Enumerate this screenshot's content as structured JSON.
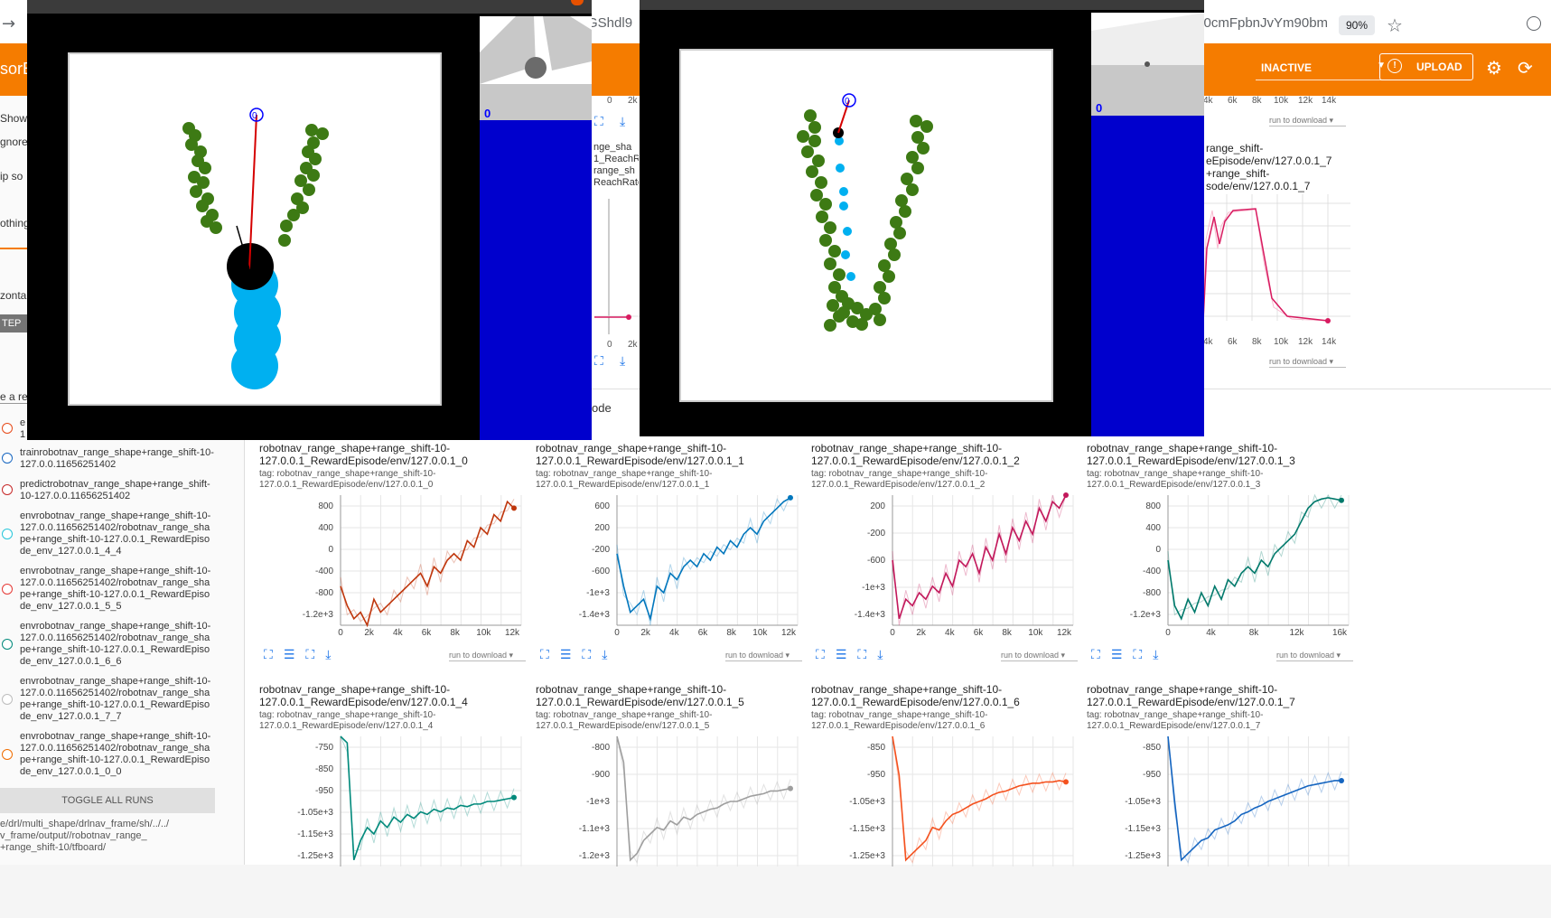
{
  "browser": {
    "address_left": "GShdl9",
    "address_right": "J0cmFpbnJvYm90bm",
    "zoom": "90%"
  },
  "toolbar": {
    "brand": "sorB",
    "status_dropdown": "INACTIVE",
    "upload_label": "UPLOAD",
    "accent_color": "#f57c00"
  },
  "sidebar": {
    "fragments": [
      "Show",
      "gnore",
      "ip so",
      "othing",
      "zontal",
      "TEP",
      "e a reg"
    ],
    "runs": [
      {
        "label": "e",
        "sub": "1",
        "color": "#e64a19"
      },
      {
        "label": "trainrobotnav_range_shape+range_shift-10-127.0.0.11656251402",
        "color": "#1565c0"
      },
      {
        "label": "predictrobotnav_range_shape+range_shift-10-127.0.0.11656251402",
        "color": "#c62828"
      },
      {
        "label": "envrobotnav_range_shape+range_shift-10-127.0.0.11656251402/robotnav_range_shape+range_shift-10-127.0.0.1_RewardEpisode_env_127.0.0.1_4_4",
        "color": "#26c6da"
      },
      {
        "label": "envrobotnav_range_shape+range_shift-10-127.0.0.11656251402/robotnav_range_shape+range_shift-10-127.0.0.1_RewardEpisode_env_127.0.0.1_5_5",
        "color": "#e53935"
      },
      {
        "label": "envrobotnav_range_shape+range_shift-10-127.0.0.11656251402/robotnav_range_shape+range_shift-10-127.0.0.1_RewardEpisode_env_127.0.0.1_6_6",
        "color": "#00897b"
      },
      {
        "label": "envrobotnav_range_shape+range_shift-10-127.0.0.11656251402/robotnav_range_shape+range_shift-10-127.0.0.1_RewardEpisode_env_127.0.0.1_7_7",
        "color": "#bdbdbd"
      },
      {
        "label": "envrobotnav_range_shape+range_shift-10-127.0.0.11656251402/robotnav_range_shape+range_shift-10-127.0.0.1_RewardEpisode_env_127.0.0.1_0_0",
        "color": "#ef6c00"
      }
    ],
    "toggle_all": "TOGGLE ALL RUNS",
    "logdir": "e/drl/multi_shape/drlnav_frame/sh/../../\nv_frame/output//robotnav_range_\n+range_shift-10/tfboard/"
  },
  "section_label": "ode",
  "top_right_card": {
    "title": "range_shift-\neEpisode/env/127.0.0.1_7\n+range_shift-\nsode/env/127.0.0.1_7",
    "xticks_top": [
      "4k",
      "6k",
      "8k",
      "10k",
      "12k",
      "14k"
    ],
    "xticks_bottom": [
      "4k",
      "6k",
      "8k",
      "10k",
      "12k",
      "14k"
    ],
    "download": "run to download"
  },
  "mid_card": {
    "title": "nge_sha\n1_ReachR\nrange_sh\nReachRate",
    "xticks": [
      "0",
      "2k"
    ]
  },
  "cards": [
    {
      "title": "robotnav_range_shape+range_shift-10-127.0.0.1_RewardEpisode/env/127.0.0.1_0",
      "tag": "tag: robotnav_range_shape+range_shift-10-127.0.0.1_RewardEpisode/env/127.0.0.1_0",
      "yticks": [
        "800",
        "400",
        "0",
        "-400",
        "-800",
        "-1.2e+3"
      ],
      "xticks": [
        "0",
        "2k",
        "4k",
        "6k",
        "8k",
        "10k",
        "12k"
      ],
      "color": "#bf360c",
      "download": "run to download"
    },
    {
      "title": "robotnav_range_shape+range_shift-10-127.0.0.1_RewardEpisode/env/127.0.0.1_1",
      "tag": "tag: robotnav_range_shape+range_shift-10-127.0.0.1_RewardEpisode/env/127.0.0.1_1",
      "yticks": [
        "600",
        "200",
        "-200",
        "-600",
        "-1e+3",
        "-1.4e+3"
      ],
      "xticks": [
        "0",
        "2k",
        "4k",
        "6k",
        "8k",
        "10k",
        "12k"
      ],
      "color": "#0277bd",
      "download": "run to download"
    },
    {
      "title": "robotnav_range_shape+range_shift-10-127.0.0.1_RewardEpisode/env/127.0.0.1_2",
      "tag": "tag: robotnav_range_shape+range_shift-10-127.0.0.1_RewardEpisode/env/127.0.0.1_2",
      "yticks": [
        "200",
        "-200",
        "-600",
        "-1e+3",
        "-1.4e+3"
      ],
      "xticks": [
        "0",
        "2k",
        "4k",
        "6k",
        "8k",
        "10k",
        "12k"
      ],
      "color": "#c2185b",
      "download": "run to download"
    },
    {
      "title": "robotnav_range_shape+range_shift-10-127.0.0.1_RewardEpisode/env/127.0.0.1_3",
      "tag": "tag: robotnav_range_shape+range_shift-10-127.0.0.1_RewardEpisode/env/127.0.0.1_3",
      "yticks": [
        "800",
        "400",
        "0",
        "-400",
        "-800",
        "-1.2e+3"
      ],
      "xticks": [
        "0",
        "4k",
        "8k",
        "12k",
        "16k"
      ],
      "color": "#00796b",
      "download": "run to download"
    },
    {
      "title": "robotnav_range_shape+range_shift-10-127.0.0.1_RewardEpisode/env/127.0.0.1_4",
      "tag": "tag: robotnav_range_shape+range_shift-10-127.0.0.1_RewardEpisode/env/127.0.0.1_4",
      "yticks": [
        "-750",
        "-850",
        "-950",
        "-1.05e+3",
        "-1.15e+3",
        "-1.25e+3"
      ],
      "xticks": [],
      "color": "#00897b",
      "download": "run to download"
    },
    {
      "title": "robotnav_range_shape+range_shift-10-127.0.0.1_RewardEpisode/env/127.0.0.1_5",
      "tag": "tag: robotnav_range_shape+range_shift-10-127.0.0.1_RewardEpisode/env/127.0.0.1_5",
      "yticks": [
        "-800",
        "-900",
        "-1e+3",
        "-1.1e+3",
        "-1.2e+3"
      ],
      "xticks": [],
      "color": "#9e9e9e",
      "download": "run to download"
    },
    {
      "title": "robotnav_range_shape+range_shift-10-127.0.0.1_RewardEpisode/env/127.0.0.1_6",
      "tag": "tag: robotnav_range_shape+range_shift-10-127.0.0.1_RewardEpisode/env/127.0.0.1_6",
      "yticks": [
        "-850",
        "-950",
        "-1.05e+3",
        "-1.15e+3",
        "-1.25e+3"
      ],
      "xticks": [],
      "color": "#f4511e",
      "download": "run to download"
    },
    {
      "title": "robotnav_range_shape+range_shift-10-127.0.0.1_RewardEpisode/env/127.0.0.1_7",
      "tag": "tag: robotnav_range_shape+range_shift-10-127.0.0.1_RewardEpisode/env/127.0.0.1_7",
      "yticks": [
        "-850",
        "-950",
        "-1.05e+3",
        "-1.15e+3",
        "-1.25e+3"
      ],
      "xticks": [],
      "color": "#1565c0",
      "download": "run to download"
    }
  ],
  "sim": {
    "left_counter": "0",
    "right_counter": "0",
    "robot_label": "0"
  }
}
